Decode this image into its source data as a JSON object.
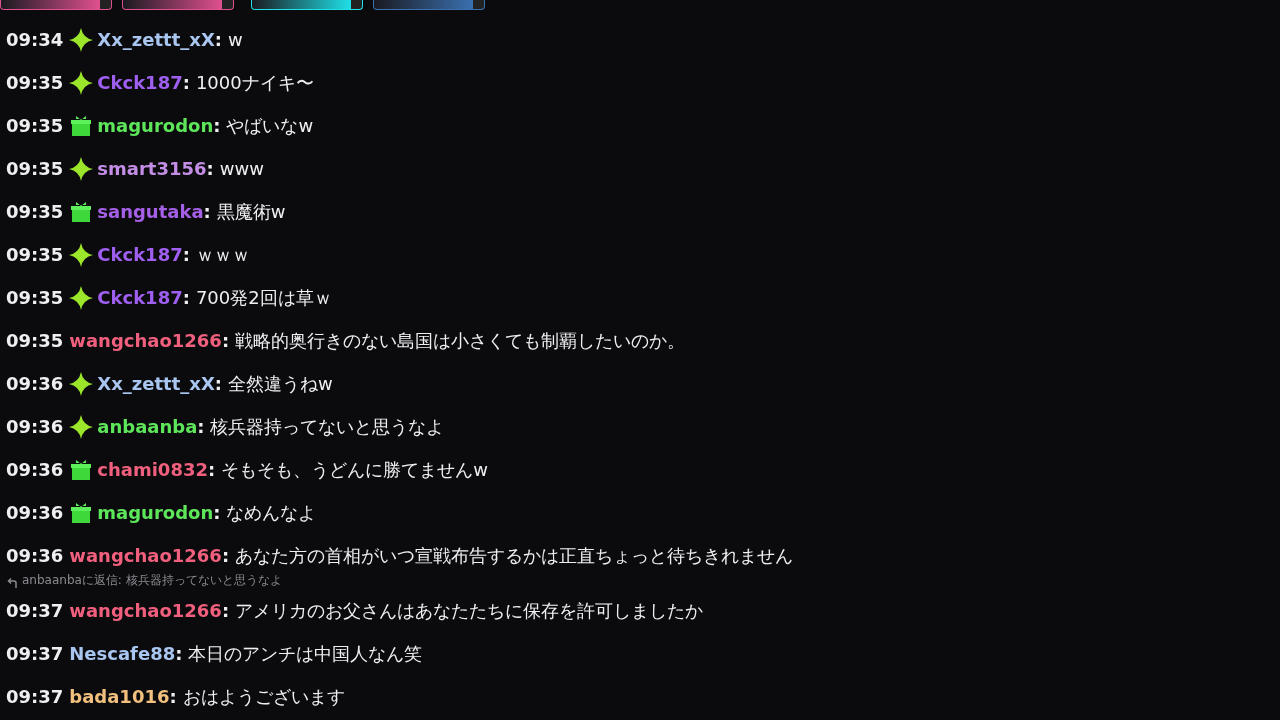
{
  "top_cards": [
    {
      "color": "#e0508f"
    },
    {
      "color": "#e0508f"
    },
    {
      "color": "#20e0e8"
    },
    {
      "color": "#3a70b0"
    }
  ],
  "messages": [
    {
      "kind": "message",
      "time": "09:34",
      "badge": {
        "kind": "sparkle"
      },
      "user": "Xx_zettt_xX",
      "color": "#a9c6f0",
      "separator": ":",
      "text": "w"
    },
    {
      "kind": "message",
      "time": "09:35",
      "badge": {
        "kind": "sparkle"
      },
      "user": "Ckck187",
      "color": "#9f5ff0",
      "separator": ":",
      "text": "1000ナイキ〜"
    },
    {
      "kind": "message",
      "time": "09:35",
      "badge": {
        "kind": "gift"
      },
      "user": "magurodon",
      "color": "#5ee65a",
      "separator": ":",
      "text": "やばいなw"
    },
    {
      "kind": "message",
      "time": "09:35",
      "badge": {
        "kind": "sparkle"
      },
      "user": "smart3156",
      "color": "#c48ee6",
      "separator": ":",
      "text": "www"
    },
    {
      "kind": "message",
      "time": "09:35",
      "badge": {
        "kind": "gift"
      },
      "user": "sangutaka",
      "color": "#a660e8",
      "separator": ":",
      "text": "黒魔術w"
    },
    {
      "kind": "message",
      "time": "09:35",
      "badge": {
        "kind": "sparkle"
      },
      "user": "Ckck187",
      "color": "#9f5ff0",
      "separator": ":",
      "text": "ｗｗｗ"
    },
    {
      "kind": "message",
      "time": "09:35",
      "badge": {
        "kind": "sparkle"
      },
      "user": "Ckck187",
      "color": "#9f5ff0",
      "separator": ":",
      "text": "700発2回は草ｗ"
    },
    {
      "kind": "message",
      "time": "09:35",
      "user": "wangchao1266",
      "color": "#f0607e",
      "separator": ":",
      "text": "戦略的奥行きのない島国は小さくても制覇したいのか。"
    },
    {
      "kind": "message",
      "time": "09:36",
      "badge": {
        "kind": "sparkle"
      },
      "user": "Xx_zettt_xX",
      "color": "#a9c6f0",
      "separator": ":",
      "text": "全然違うねw"
    },
    {
      "kind": "message",
      "time": "09:36",
      "badge": {
        "kind": "sparkle"
      },
      "user": "anbaanba",
      "color": "#5ee65a",
      "separator": ":",
      "text": "核兵器持ってないと思うなよ"
    },
    {
      "kind": "message",
      "time": "09:36",
      "badge": {
        "kind": "gift"
      },
      "user": "chami0832",
      "color": "#f0607e",
      "separator": ":",
      "text": "そもそも、うどんに勝てませんw"
    },
    {
      "kind": "message",
      "time": "09:36",
      "badge": {
        "kind": "gift"
      },
      "user": "magurodon",
      "color": "#5ee65a",
      "separator": ":",
      "text": "なめんなよ"
    },
    {
      "kind": "message",
      "time": "09:36",
      "user": "wangchao1266",
      "color": "#f0607e",
      "separator": ":",
      "text": "あなた方の首相がいつ宣戦布告するかは正直ちょっと待ちきれません"
    },
    {
      "kind": "reply",
      "text": "anbaanbaに返信: 核兵器持ってないと思うなよ"
    },
    {
      "kind": "message",
      "time": "09:37",
      "user": "wangchao1266",
      "color": "#f0607e",
      "separator": ":",
      "text": "アメリカのお父さんはあなたたちに保存を許可しましたか"
    },
    {
      "kind": "message",
      "time": "09:37",
      "user": "Nescafe88",
      "color": "#a9c6f0",
      "separator": ":",
      "text": "本日のアンチは中国人なん笑"
    },
    {
      "kind": "message",
      "time": "09:37",
      "user": "bada1016",
      "color": "#f2c07e",
      "separator": ":",
      "text": "おはようございます"
    }
  ]
}
